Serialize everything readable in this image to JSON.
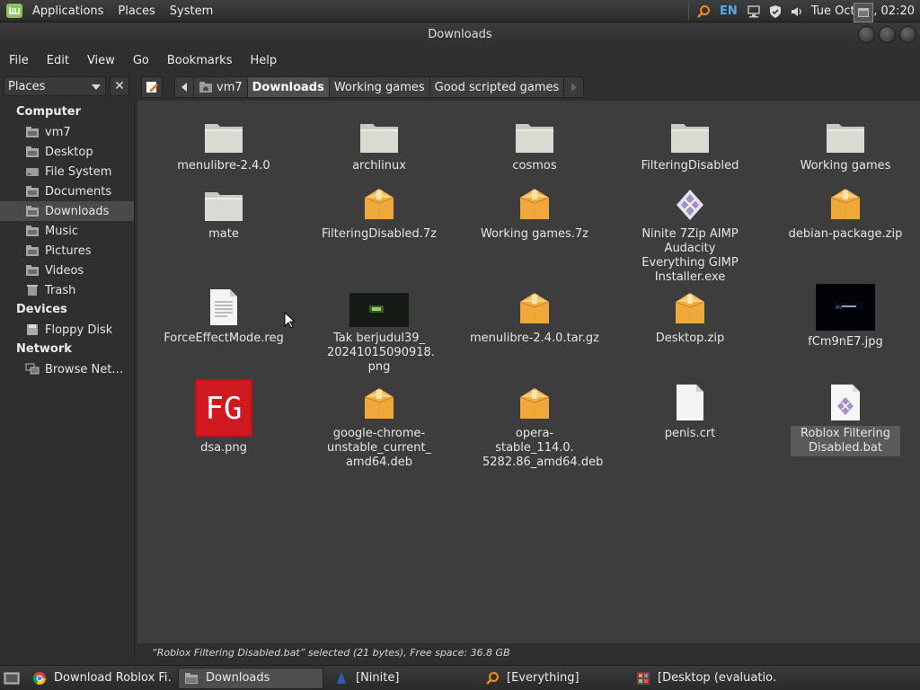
{
  "topbar": {
    "menus": [
      "Applications",
      "Places",
      "System"
    ],
    "lang": "EN",
    "clock": "Tue Oct 15, 02:20"
  },
  "window": {
    "title": "Downloads"
  },
  "menubar": [
    "File",
    "Edit",
    "View",
    "Go",
    "Bookmarks",
    "Help"
  ],
  "toolbar": {
    "places_label": "Places",
    "breadcrumbs": [
      "vm7",
      "Downloads",
      "Working games",
      "Good scripted games"
    ],
    "active_crumb": "Downloads"
  },
  "sidebar": {
    "computer_head": "Computer",
    "computer_items": [
      "vm7",
      "Desktop",
      "File System",
      "Documents",
      "Downloads",
      "Music",
      "Pictures",
      "Videos",
      "Trash"
    ],
    "devices_head": "Devices",
    "devices_items": [
      "Floppy Disk"
    ],
    "network_head": "Network",
    "network_items": [
      "Browse Net…"
    ],
    "active": "Downloads"
  },
  "files": [
    {
      "name": "menulibre-2.4.0",
      "type": "folder"
    },
    {
      "name": "archlinux",
      "type": "folder"
    },
    {
      "name": "cosmos",
      "type": "folder"
    },
    {
      "name": "FilteringDisabled",
      "type": "folder"
    },
    {
      "name": "Working games",
      "type": "folder"
    },
    {
      "name": "mate",
      "type": "folder"
    },
    {
      "name": "FilteringDisabled.7z",
      "type": "archive"
    },
    {
      "name": "Working games.7z",
      "type": "archive"
    },
    {
      "name": "Ninite 7Zip AIMP Audacity Everything GIMP Installer.exe",
      "type": "exe"
    },
    {
      "name": "debian-package.zip",
      "type": "archive"
    },
    {
      "name": "ForceEffectMode.reg",
      "type": "text"
    },
    {
      "name": "Tak berjudul39_ 20241015090918. png",
      "type": "image-dark"
    },
    {
      "name": "menulibre-2.4.0.tar.gz",
      "type": "archive"
    },
    {
      "name": "Desktop.zip",
      "type": "archive"
    },
    {
      "name": "fCm9nE7.jpg",
      "type": "image-black"
    },
    {
      "name": "dsa.png",
      "type": "image-fg"
    },
    {
      "name": "google-chrome- unstable_current_ amd64.deb",
      "type": "archive"
    },
    {
      "name": "opera-stable_114.0. 5282.86_amd64.deb",
      "type": "archive"
    },
    {
      "name": "penis.crt",
      "type": "blank"
    },
    {
      "name": "Roblox Filtering Disabled.bat",
      "type": "exe-doc",
      "selected": true
    }
  ],
  "status": "“Roblox Filtering Disabled.bat” selected (21 bytes), Free space: 36.8 GB",
  "taskbar": [
    {
      "label": "Download Roblox Fi…",
      "icon": "chrome-icon"
    },
    {
      "label": "Downloads",
      "icon": "folder-icon",
      "active": true
    },
    {
      "label": "[Ninite]",
      "icon": "ninite-icon"
    },
    {
      "label": "[Everything]",
      "icon": "everything-icon"
    },
    {
      "label": "[Desktop (evaluatio…",
      "icon": "desktop-icon"
    }
  ],
  "fg_text": "FG"
}
